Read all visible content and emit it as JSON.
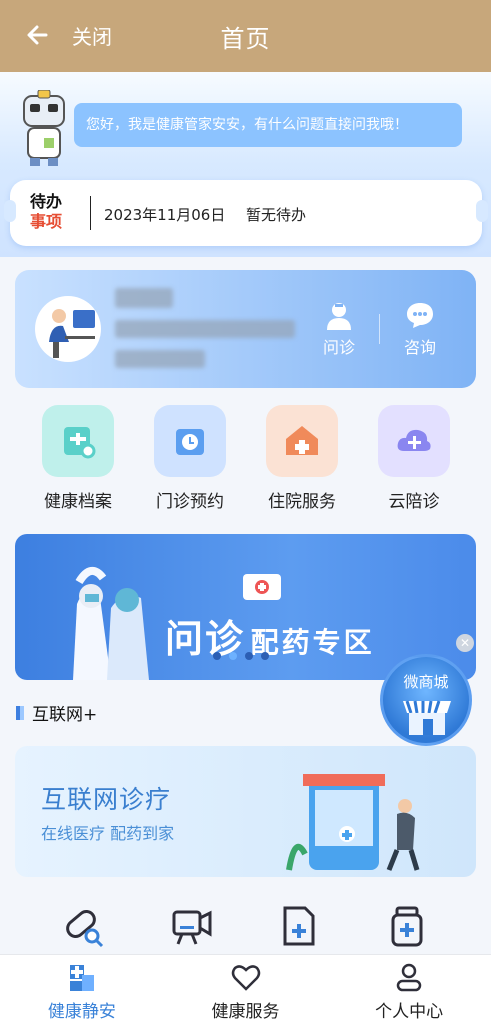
{
  "header": {
    "close_label": "关闭",
    "title": "首页"
  },
  "assistant": {
    "message": "您好，我是健康管家安安，有什么问题直接问我哦！"
  },
  "todo": {
    "badge_line1": "待办",
    "badge_line2": "事项",
    "date": "2023年11月06日",
    "status": "暂无待办"
  },
  "profile": {
    "actions": [
      {
        "label": "问诊",
        "icon": "doctor-icon"
      },
      {
        "label": "咨询",
        "icon": "chat-icon"
      }
    ]
  },
  "quick_menu": [
    {
      "label": "健康档案",
      "icon": "health-record-icon",
      "color": "#5ad0c9"
    },
    {
      "label": "门诊预约",
      "icon": "clock-calendar-icon",
      "color": "#5b9ef0"
    },
    {
      "label": "住院服务",
      "icon": "hospital-house-icon",
      "color": "#f08a5a"
    },
    {
      "label": "云陪诊",
      "icon": "cloud-plus-icon",
      "color": "#8a86f0"
    }
  ],
  "banner": {
    "text_big": "问诊",
    "text_small": "配药专区",
    "slide_count": 4,
    "active_slide": 2
  },
  "floating": {
    "label": "微商城",
    "close_glyph": "✕"
  },
  "section": {
    "title": "互联网+"
  },
  "internet_card": {
    "title": "互联网诊疗",
    "subtitle": "在线医疗 配药到家"
  },
  "tools": [
    "pill-search-icon",
    "video-consult-icon",
    "add-document-icon",
    "medicine-bottle-icon"
  ],
  "tabbar": [
    {
      "label": "健康静安",
      "icon": "home-plus-icon",
      "active": true
    },
    {
      "label": "健康服务",
      "icon": "heart-icon",
      "active": false
    },
    {
      "label": "个人中心",
      "icon": "user-icon",
      "active": false
    }
  ],
  "colors": {
    "header_bg": "#c7a77b",
    "accent": "#3a82d8",
    "todo_red": "#e64d33"
  }
}
